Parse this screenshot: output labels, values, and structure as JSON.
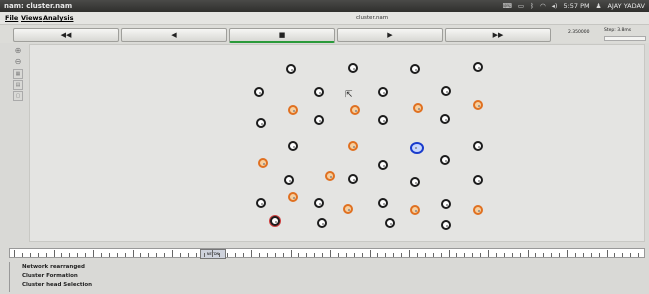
{
  "window": {
    "title": "nam: cluster.nam",
    "document_title": "cluster.nam",
    "clock": "5:57 PM",
    "user": "AJAY YADAV"
  },
  "menu": [
    "File",
    "Views",
    "Analysis"
  ],
  "controls": {
    "rewind": "◀◀",
    "back": "◀",
    "stop": "■",
    "play": "▶",
    "fast_forward": "▶▶",
    "time": "2.350000",
    "step": "Step: 3.8ms"
  },
  "timeline": {
    "handle_label": "NETDN"
  },
  "log": [
    "Network rearranged",
    "Cluster Formation",
    "Cluster head Selection"
  ],
  "colors": {
    "normal_node": "#1c1c1c",
    "cluster_head": "#e07020",
    "base_station": "#1a3ccc",
    "sink_ring": "#d04040"
  }
}
